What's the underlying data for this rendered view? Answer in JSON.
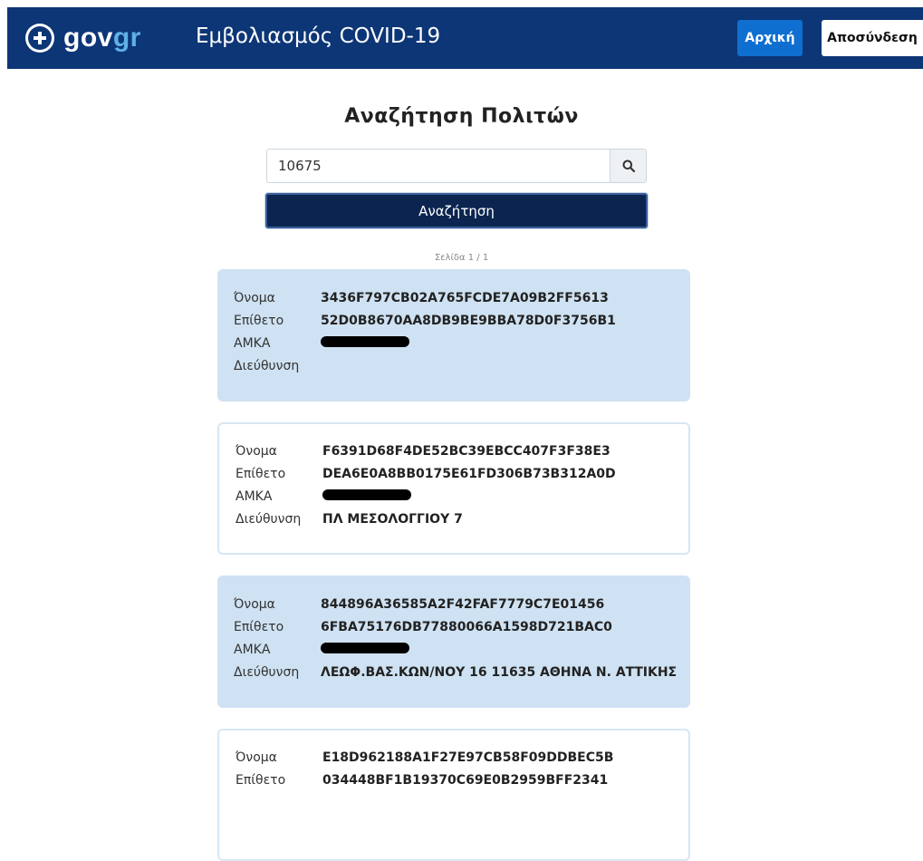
{
  "header": {
    "logo_gov": "gov",
    "logo_gr": "gr",
    "app_title": "Εμβολιασμός COVID-19",
    "home_label": "Αρχική",
    "logout_label": "Αποσύνδεση"
  },
  "page": {
    "title": "Αναζήτηση Πολιτών",
    "search_value": "10675",
    "search_button": "Αναζήτηση",
    "page_info": "Σελίδα 1 / 1"
  },
  "labels": {
    "name": "Όνομα",
    "surname": "Επίθετο",
    "amka": "ΑΜΚΑ",
    "address": "Διεύθυνση"
  },
  "results": [
    {
      "name": "3436F797CB02A765FCDE7A09B2FF5613",
      "surname": "52D0B8670AA8DB9BE9BBA78D0F3756B1",
      "address": ""
    },
    {
      "name": "F6391D68F4DE52BC39EBCC407F3F38E3",
      "surname": "DEA6E0A8BB0175E61FD306B73B312A0D",
      "address": "ΠΛ ΜΕΣΟΛΟΓΓΙΟΥ 7"
    },
    {
      "name": "844896A36585A2F42FAF7779C7E01456",
      "surname": "6FBA75176DB77880066A1598D721BAC0",
      "address": "ΛΕΩΦ.ΒΑΣ.ΚΩΝ/ΝΟΥ 16 11635 ΑΘΗΝΑ Ν. ΑΤΤΙΚΗΣ"
    },
    {
      "name": "E18D962188A1F27E97CB58F09DDBEC5B",
      "surname": "034448BF1B19370C69E0B2959BFF2341",
      "address": ""
    }
  ]
}
